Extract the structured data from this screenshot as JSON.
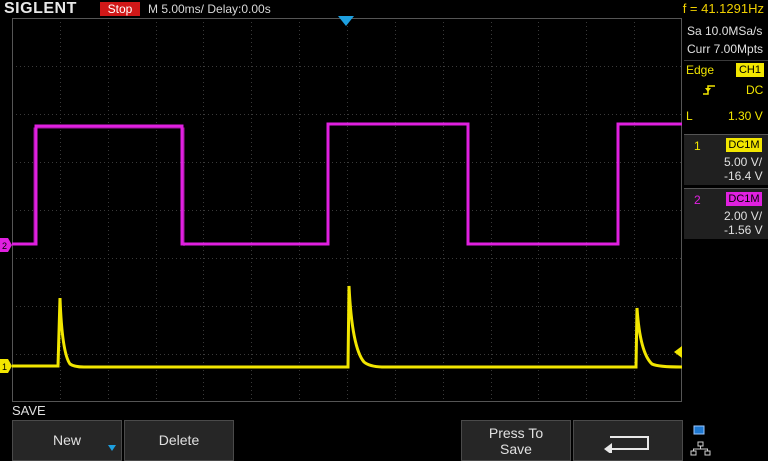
{
  "header": {
    "brand": "SIGLENT",
    "run_state": "Stop",
    "timebase": "M 5.00ms/ Delay:0.00s",
    "frequency": "f = 41.1291Hz"
  },
  "acquisition": {
    "sample_rate": "Sa 10.0MSa/s",
    "memory": "Curr 7.00Mpts"
  },
  "trigger": {
    "type": "Edge",
    "source": "CH1",
    "coupling": "DC",
    "level_label": "L",
    "level": "1.30 V"
  },
  "channels": [
    {
      "number": "1",
      "coupling": "DC1M",
      "scale": "5.00 V/",
      "offset": "-16.4 V",
      "color": "#f2e600"
    },
    {
      "number": "2",
      "coupling": "DC1M",
      "scale": "2.00 V/",
      "offset": "-1.56 V",
      "color": "#e020e0"
    }
  ],
  "menu": {
    "title": "SAVE",
    "new_label": "New",
    "delete_label": "Delete",
    "press_to_save_line1": "Press To",
    "press_to_save_line2": "Save"
  },
  "colors": {
    "ch1": "#f2e600",
    "ch2": "#e020e0",
    "stop": "#d01818",
    "trigger_marker": "#1ea0e0"
  },
  "icons": [
    "usb-icon",
    "network-icon",
    "return-icon",
    "trigger-rising-edge-icon"
  ]
}
